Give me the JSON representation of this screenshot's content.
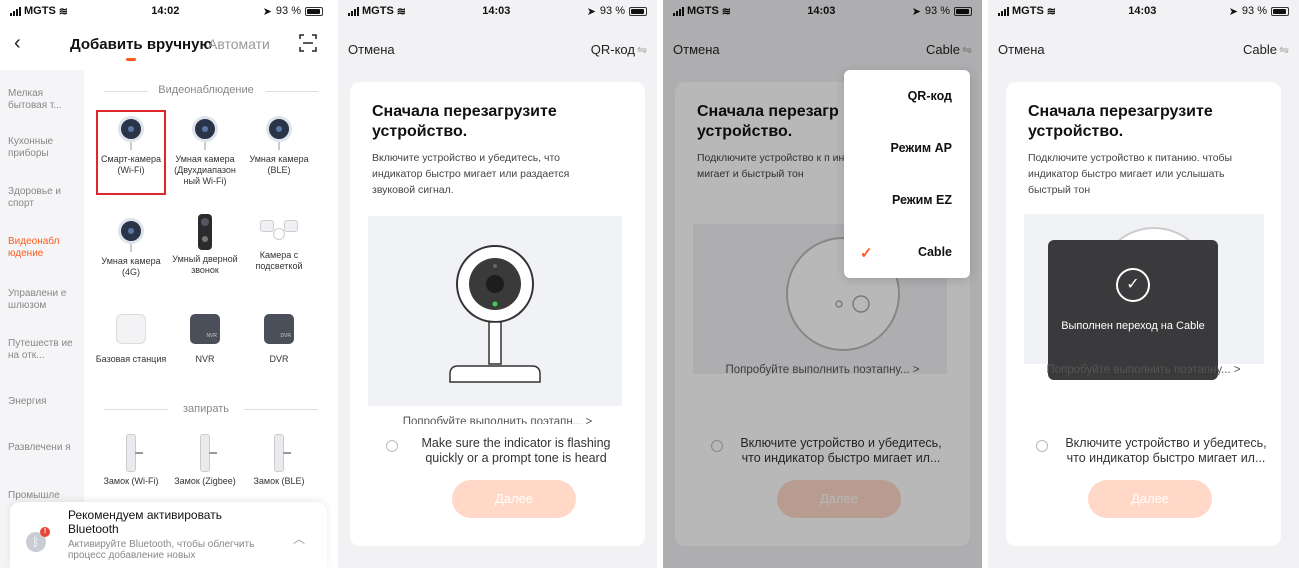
{
  "status": {
    "s1": {
      "carrier": "MGTS",
      "time": "14:02",
      "battery": "93 %"
    },
    "s2": {
      "carrier": "MGTS",
      "time": "14:03",
      "battery": "93 %"
    },
    "s3": {
      "carrier": "MGTS",
      "time": "14:03",
      "battery": "93 %"
    },
    "s4": {
      "carrier": "MGTS",
      "time": "14:03",
      "battery": "93 %"
    }
  },
  "screen1": {
    "tab_active": "Добавить вручную",
    "tab_inactive": "Автомати",
    "sidebar": [
      "Мелкая бытовая т...",
      "Кухонные приборы",
      "Здоровье и спорт",
      "Видеонабл юдение",
      "Управлени е шлюзом",
      "Путешеств ие на отк...",
      "Энергия",
      "Развлечени я",
      "Промышле"
    ],
    "section_video": "Видеонаблюдение",
    "devices": [
      "Смарт-камера (Wi-Fi)",
      "Умная камера (Двухдиапазон ный Wi-Fi)",
      "Умная камера (BLE)",
      "Умная камера (4G)",
      "Умный дверной звонок",
      "Камера с подсветкой",
      "Базовая станция",
      "NVR",
      "DVR"
    ],
    "nvr_label": "NVR",
    "dvr_label": "DVR",
    "section_lock": "запирать",
    "locks": [
      "Замок (Wi-Fi)",
      "Замок (Zigbee)",
      "Замок (BLE)"
    ],
    "banner": {
      "title": "Рекомендуем активировать Bluetooth",
      "subtitle": "Активируйте Bluetooth, чтобы облегчить процесс добавление новых",
      "badge": "!"
    }
  },
  "screen2": {
    "cancel": "Отмена",
    "mode": "QR-код",
    "title": "Сначала перезагрузите устройство.",
    "desc": "Включите устройство и убедитесь, что индикатор быстро мигает или раздается звуковой сигнал.",
    "try": "Попробуйте выполнить поэтапн... >",
    "check": "Make sure the indicator is flashing quickly or a prompt tone is heard",
    "next": "Далее"
  },
  "screen3": {
    "cancel": "Отмена",
    "mode": "Cable",
    "title": "Сначала перезагр устройство.",
    "desc": "Подключите устройство к п индикатор быстро мигает и быстрый тон",
    "try": "Попробуйте выполнить поэтапну... >",
    "check": "Включите устройство и убедитесь, что индикатор быстро мигает ил...",
    "next": "Далее",
    "menu": [
      "QR-код",
      "Режим AP",
      "Режим EZ",
      "Cable"
    ],
    "menu_check": "✓"
  },
  "screen4": {
    "cancel": "Отмена",
    "mode": "Cable",
    "title": "Сначала перезагрузите устройство.",
    "desc": "Подключите устройство к питанию. чтобы индикатор быстро мигает или услышать быстрый тон",
    "try": "Попробуйте выполнить поэтапну... >",
    "check": "Включите устройство и убедитесь, что индикатор быстро мигает ил...",
    "next": "Далее",
    "toast": "Выполнен переход на Cable",
    "toast_check": "✓"
  },
  "icons": {
    "back": "chevron-left-icon",
    "scan": "scan-icon",
    "switch": "switch-arrows-icon",
    "bluetooth": "bluetooth-icon"
  },
  "colors": {
    "accent": "#ff5a1f",
    "next_btn": "#ffd8c7",
    "selection": "#e0262a",
    "toast": "#3a3a3c"
  }
}
